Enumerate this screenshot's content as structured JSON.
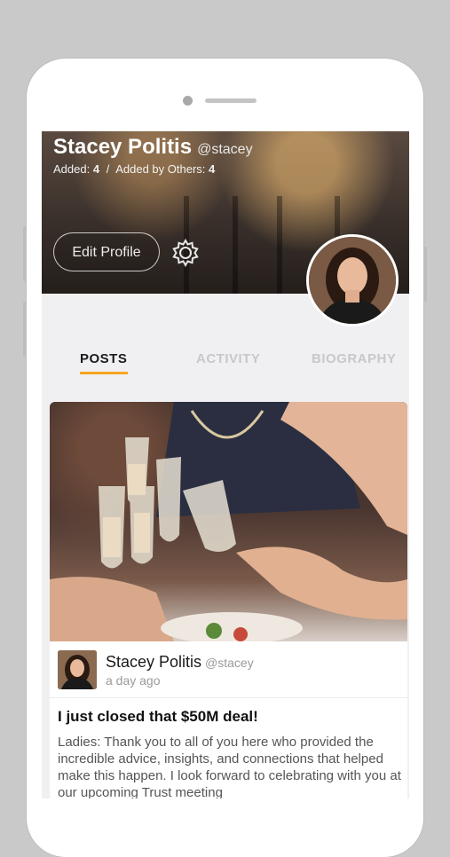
{
  "profile": {
    "name": "Stacey Politis",
    "handle": "@stacey",
    "added_label": "Added:",
    "added_count": "4",
    "separator": "/",
    "added_by_others_label": "Added by Others:",
    "added_by_others_count": "4",
    "edit_button": "Edit Profile",
    "settings_icon": "gear-icon"
  },
  "tabs": [
    {
      "label": "POSTS",
      "active": true
    },
    {
      "label": "ACTIVITY",
      "active": false
    },
    {
      "label": "BIOGRAPHY",
      "active": false
    }
  ],
  "colors": {
    "accent": "#f5a623",
    "screen_bg": "#f0f0f3",
    "frame_bg": "#c9c9c9"
  },
  "post": {
    "author_name": "Stacey Politis",
    "author_handle": "@stacey",
    "time": "a day ago",
    "title": "I just closed that $50M deal!",
    "body": "Ladies: Thank you to all of you here who provided the incredible advice, insights, and connections that helped make this happen. I look forward to celebrating with you at our upcoming Trust meeting"
  }
}
